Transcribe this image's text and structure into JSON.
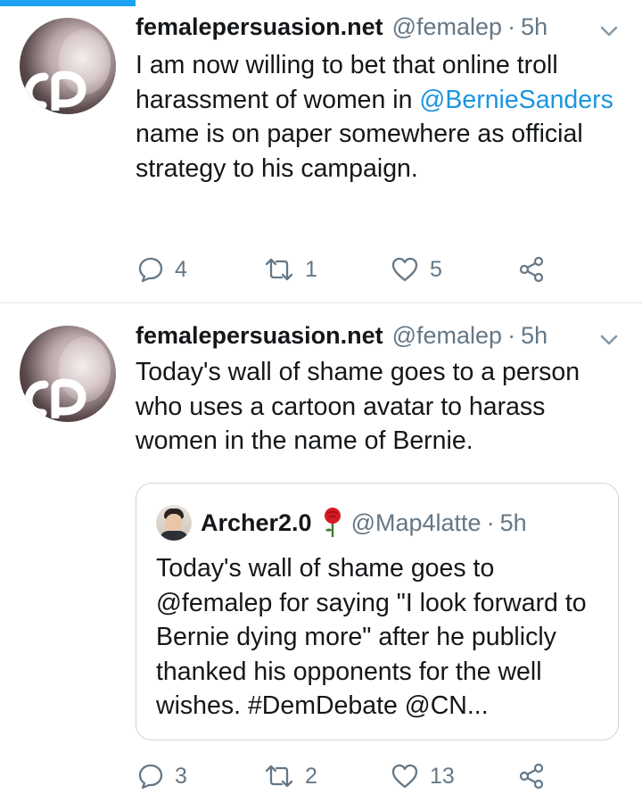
{
  "colors": {
    "accent": "#1da1f2",
    "link": "#1b95e0",
    "secondary_text": "#657786",
    "border": "#e1e8ed"
  },
  "tweets": [
    {
      "name": "femalepersuasion.net",
      "handle": "@femalep",
      "separator": "·",
      "time": "5h",
      "text_before": "I am now willing to bet that online troll harassment of women in ",
      "mention": "@BernieSanders",
      "text_after": " name is on paper somewhere as official strategy to his campaign.",
      "replies": "4",
      "retweets": "1",
      "likes": "5"
    },
    {
      "name": "femalepersuasion.net",
      "handle": "@femalep",
      "separator": "·",
      "time": "5h",
      "text": "Today's wall of shame goes to a person who uses a cartoon avatar to harass women in the name of Bernie.",
      "replies": "3",
      "retweets": "2",
      "likes": "13",
      "quote": {
        "name": "Archer2.0",
        "handle": "@Map4latte",
        "separator": "·",
        "time": "5h",
        "text": "Today's wall of shame goes to @femalep for saying \"I look forward to Bernie dying more\" after he publicly thanked his opponents for the well wishes. #DemDebate @CN..."
      }
    }
  ],
  "icons": {
    "reply": "reply-icon",
    "retweet": "retweet-icon",
    "like": "heart-icon",
    "share": "share-icon",
    "menu": "chevron-down-icon",
    "rose": "rose-emoji-icon"
  }
}
